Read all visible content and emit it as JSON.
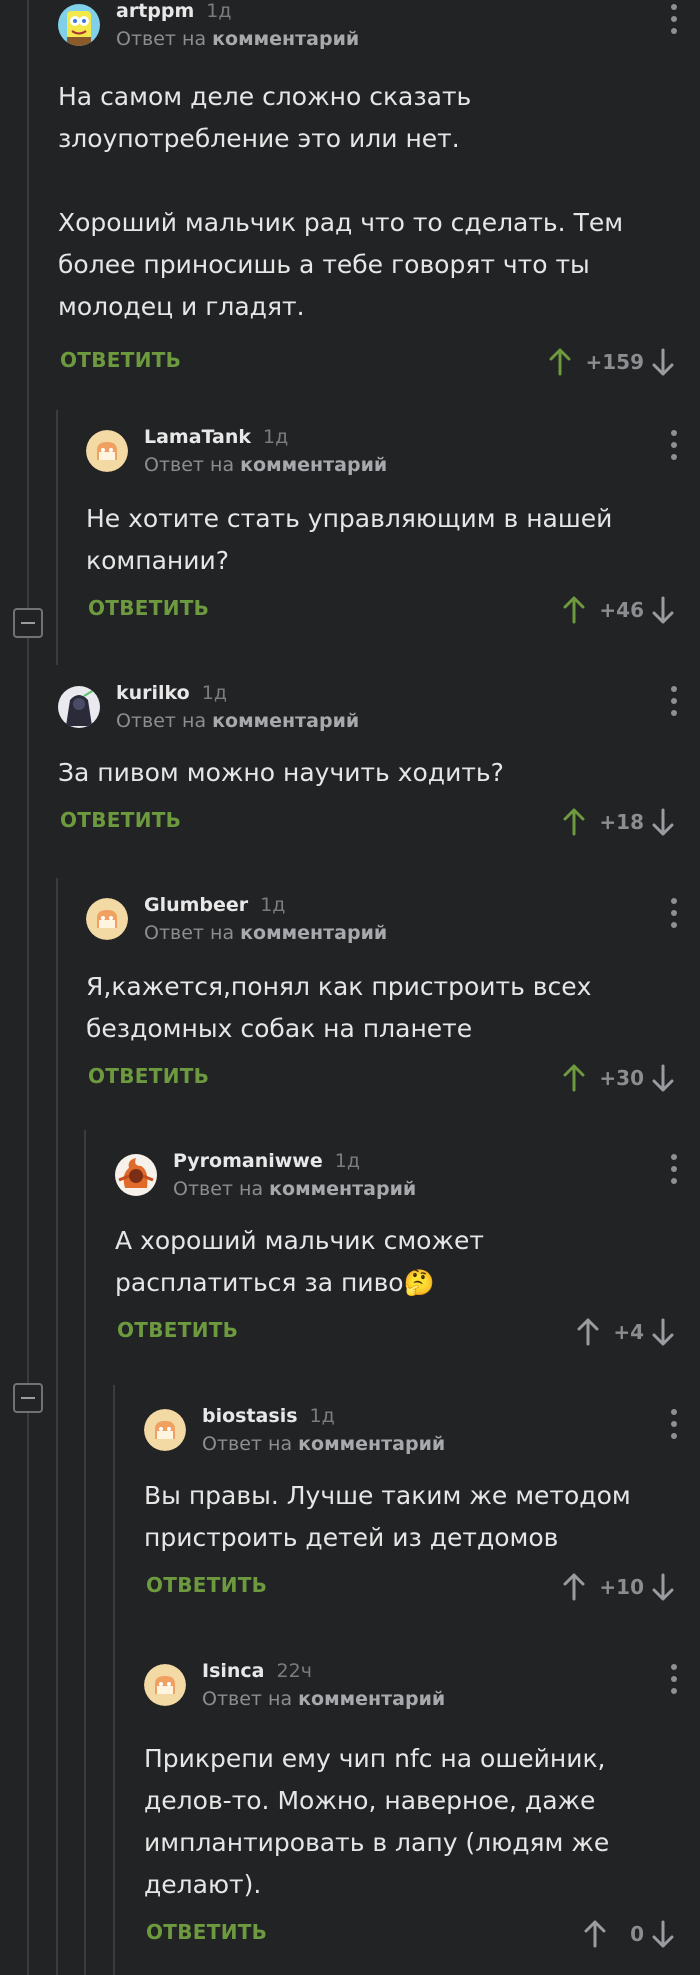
{
  "reply_to_prefix": "Ответ на",
  "reply_to_target": "комментарий",
  "reply_label": "ОТВЕТИТЬ",
  "colors": {
    "background": "#222325",
    "accent_green": "#6d9a3f",
    "upvote_active": "#6d9a3f",
    "upvote_idle": "#9a9c9f"
  },
  "comments": [
    {
      "author": "artppm",
      "time": "1д",
      "avatar_icon": "spongebob-avatar",
      "text": "На самом деле сложно сказать злоупотребление это или нет.\n\nХороший мальчик рад что то сделать. Тем более приносишь а тебе говорят что ты молодец и гладят.",
      "score": "+159",
      "upvoted": true
    },
    {
      "author": "LamaTank",
      "time": "1д",
      "avatar_icon": "default-avatar",
      "text": "Не хотите стать управляющим в нашей компании?",
      "score": "+46",
      "upvoted": true
    },
    {
      "author": "kurilko",
      "time": "1д",
      "avatar_icon": "dark-character-avatar",
      "text": "За пивом можно научить ходить?",
      "score": "+18",
      "upvoted": true
    },
    {
      "author": "Glumbeer",
      "time": "1д",
      "avatar_icon": "default-avatar",
      "text": "Я,кажется,понял как пристроить всех бездомных собак на планете",
      "score": "+30",
      "upvoted": true
    },
    {
      "author": "Pyromaniwwe",
      "time": "1д",
      "avatar_icon": "fire-character-avatar",
      "text": "А хороший мальчик сможет расплатиться за пиво🤔",
      "score": "+4",
      "upvoted": false
    },
    {
      "author": "biostasis",
      "time": "1д",
      "avatar_icon": "default-avatar",
      "text": "Вы правы. Лучше таким же методом пристроить детей из детдомов",
      "score": "+10",
      "upvoted": false
    },
    {
      "author": "Isinca",
      "time": "22ч",
      "avatar_icon": "default-avatar",
      "text": "Прикрепи ему чип nfc на ошейник, делов-то. Можно, наверное, даже имплантировать в лапу (людям же делают).",
      "score": "0",
      "upvoted": false
    }
  ]
}
